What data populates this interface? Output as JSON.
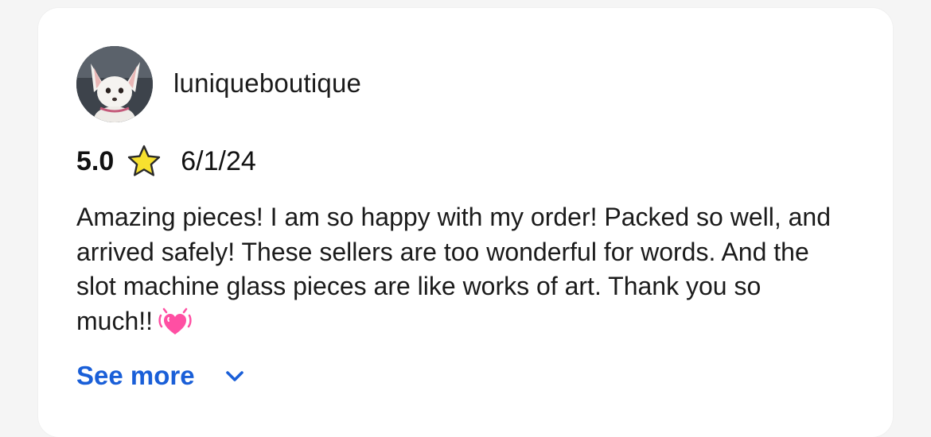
{
  "review": {
    "username": "luniqueboutique",
    "avatar_alt": "dog avatar",
    "rating": "5.0",
    "rating_icon": "star-icon",
    "date": "6/1/24",
    "text": "Amazing pieces! I am so happy with my order! Packed so well, and arrived safely! These sellers are too wonderful for words. And the slot machine glass pieces are like works of art. Thank you so much!!",
    "emoji_icon": "heart-icon",
    "see_more_label": "See more",
    "expand_icon": "chevron-down-icon"
  },
  "colors": {
    "background": "#f5f5f5",
    "card": "#ffffff",
    "text": "#1b1b1b",
    "link": "#1a5fd8",
    "star": "#f7e12f",
    "heart": "#ff4fa3"
  }
}
